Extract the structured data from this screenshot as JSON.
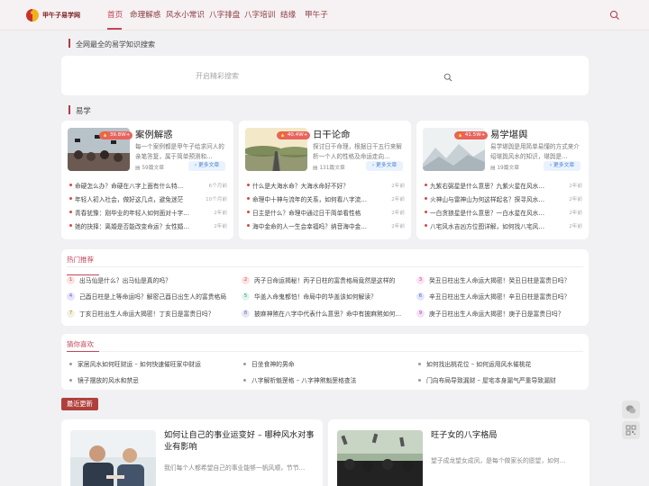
{
  "header": {
    "logo_text": "甲午子易学网",
    "nav": [
      {
        "label": "首页",
        "active": true
      },
      {
        "label": "命理解惑"
      },
      {
        "label": "风水小常识"
      },
      {
        "label": "八字排盘"
      },
      {
        "label": "八字培训"
      },
      {
        "label": "结缘"
      },
      {
        "label": "甲午子"
      }
    ]
  },
  "search": {
    "section_label": "全网最全的易学知识搜索",
    "placeholder": "开启精彩搜索"
  },
  "yixue": {
    "label": "易学",
    "more_label": "更多文章",
    "cards": [
      {
        "title": "案例解惑",
        "badge": "39.8W+",
        "desc": "每一个案例都是甲午子给求问人的亲笔答复，属于简单预测和…",
        "count": "59篇文章",
        "items": [
          {
            "title": "命硬怎么办？命硬在八字上面有什么特…",
            "date": "6个月前"
          },
          {
            "title": "年轻人初入社会，做好这几点，避免迷茫",
            "date": "10个月前"
          },
          {
            "title": "青春犹豫：刚毕业的年轻人如何面对十字…",
            "date": "2年前"
          },
          {
            "title": "她的抉择：离婚是否能改变命运？女性婚…",
            "date": "2年前"
          }
        ]
      },
      {
        "title": "日干论命",
        "badge": "40.4W+",
        "desc": "探讨日干命理，根据日干五行来解析一个人的性格及命运走向…",
        "count": "131篇文章",
        "items": [
          {
            "title": "什么是大海水命？大海水命好不好？",
            "date": "2年前"
          },
          {
            "title": "命理中十神与流年的关系，如何看八字流…",
            "date": "2年前"
          },
          {
            "title": "日主是什么？命理中通过日干简单看性格",
            "date": "2年前"
          },
          {
            "title": "海中金命的人一生会幸福吗？纳音海中金…",
            "date": "2年前"
          }
        ]
      },
      {
        "title": "易学堪舆",
        "badge": "41.5W+",
        "desc": "易学堪舆是用简单易懂的方式来介绍堪舆风水的知识，堪舆是…",
        "count": "19篇文章",
        "items": [
          {
            "title": "九紫右弼星是什么意思？九紫火星在风水…",
            "date": "2年前"
          },
          {
            "title": "火神山与雷神山为何这样起名？探寻风水…",
            "date": "2年前"
          },
          {
            "title": "一白贪狼星是什么意思？一白水星在风水…",
            "date": "2年前"
          },
          {
            "title": "八宅风水吉凶方位图详解，如何找八宅风…",
            "date": "2年前"
          }
        ]
      }
    ]
  },
  "hot": {
    "title": "热门推荐",
    "num_colors": [
      "#fde1e1",
      "#fde1e1",
      "#f9e3f1",
      "#e8e2fb",
      "#e2f4ee",
      "#e3e6fb",
      "#f4f1e2",
      "#e6e6f5",
      "#f3e2f4"
    ],
    "num_text_colors": [
      "#d34848",
      "#d34848",
      "#c0449a",
      "#7a5ad0",
      "#2f9a73",
      "#4a62d0",
      "#a08b30",
      "#6a6ab0",
      "#b046b6"
    ],
    "items": [
      {
        "num": "1",
        "title": "出马仙是什么？出马仙是真的吗？"
      },
      {
        "num": "2",
        "title": "丙子日命运揭秘！丙子日柱的富贵格局竟然是这样的"
      },
      {
        "num": "3",
        "title": "癸丑日柱出生人命运大揭密！癸丑日柱是富贵日吗？"
      },
      {
        "num": "4",
        "title": "己酉日柱是上等命运吗？解密己酉日出生人的富贵格局"
      },
      {
        "num": "5",
        "title": "华盖入命鬼都怕！命局中的华盖该如何解读？"
      },
      {
        "num": "6",
        "title": "辛丑日柱出生人命运大揭密！辛丑日柱是富贵日吗？"
      },
      {
        "num": "7",
        "title": "丁亥日柱出生人命运大揭密！丁亥日是富贵日吗？"
      },
      {
        "num": "8",
        "title": "披麻神煞在八字中代表什么意思？命中有披麻煞如何…"
      },
      {
        "num": "9",
        "title": "庚子日柱出生人命运大揭密！庚子日是富贵日吗？"
      }
    ]
  },
  "guess": {
    "title": "猜你喜欢",
    "items": [
      {
        "title": "家居风水如何旺财运 – 如何快速催旺家中财运"
      },
      {
        "title": "日坐食神的男命"
      },
      {
        "title": "如何找出桃花位 – 如何运用风水催桃花"
      },
      {
        "title": "镜子摆放的风水和禁忌"
      },
      {
        "title": "八字解析魁罡格 – 八字神煞魁罡格查法"
      },
      {
        "title": "门向布局导致漏财 – 屋宅本身漏气严重导致漏财"
      }
    ]
  },
  "latest": {
    "label": "最近更新",
    "posts": [
      {
        "title": "如何让自己的事业运变好 – 哪种风水对事业有影响",
        "desc": "我们每个人都希望自己的事业能够一帆风顺，节节…"
      },
      {
        "title": "旺子女的八字格局",
        "desc": "望子成龙望女成凤，是每个做家长的愿望，如何…"
      }
    ]
  },
  "floats": [
    {
      "icon": "wechat-icon"
    },
    {
      "icon": "qrcode-icon"
    }
  ]
}
